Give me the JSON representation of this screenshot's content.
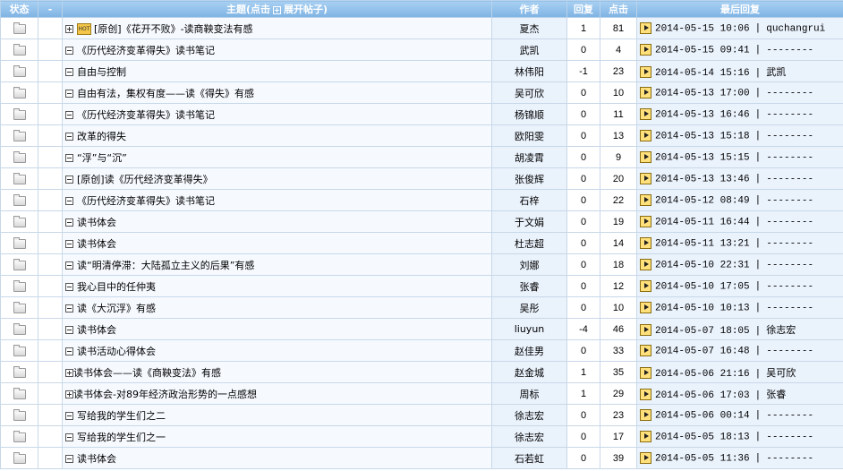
{
  "header": {
    "status": "状态",
    "dash": "-",
    "topic_prefix": "主题(点击",
    "topic_suffix": "展开帖子)",
    "author": "作者",
    "replies": "回复",
    "clicks": "点击",
    "last_reply": "最后回复"
  },
  "hot_badge": "HOT",
  "rows": [
    {
      "title": "[原创]《花开不败》-读商鞅变法有感",
      "expander": "plus",
      "hot": true,
      "author": "夏杰",
      "replies": "1",
      "clicks": "81",
      "date": "2014-05-15 10:06",
      "last_user": "quchangrui"
    },
    {
      "title": "《历代经济变革得失》读书笔记",
      "expander": "minus",
      "hot": false,
      "author": "武凯",
      "replies": "0",
      "clicks": "4",
      "date": "2014-05-15 09:41",
      "last_user": "--------"
    },
    {
      "title": "自由与控制",
      "expander": "minus",
      "hot": false,
      "author": "林伟阳",
      "replies": "-1",
      "clicks": "23",
      "date": "2014-05-14 15:16",
      "last_user": "武凯"
    },
    {
      "title": "自由有法，集权有度——读《得失》有感",
      "expander": "minus",
      "hot": false,
      "author": "吴可欣",
      "replies": "0",
      "clicks": "10",
      "date": "2014-05-13 17:00",
      "last_user": "--------"
    },
    {
      "title": "《历代经济变革得失》读书笔记",
      "expander": "minus",
      "hot": false,
      "author": "杨锦顺",
      "replies": "0",
      "clicks": "11",
      "date": "2014-05-13 16:46",
      "last_user": "--------"
    },
    {
      "title": "改革的得失",
      "expander": "minus",
      "hot": false,
      "author": "欧阳雯",
      "replies": "0",
      "clicks": "13",
      "date": "2014-05-13 15:18",
      "last_user": "--------"
    },
    {
      "title": "“浮”与“沉”",
      "expander": "minus",
      "hot": false,
      "author": "胡凌霄",
      "replies": "0",
      "clicks": "9",
      "date": "2014-05-13 15:15",
      "last_user": "--------"
    },
    {
      "title": "[原创]读《历代经济变革得失》",
      "expander": "minus",
      "hot": false,
      "author": "张俊辉",
      "replies": "0",
      "clicks": "20",
      "date": "2014-05-13 13:46",
      "last_user": "--------"
    },
    {
      "title": "《历代经济变革得失》读书笔记",
      "expander": "minus",
      "hot": false,
      "author": "石梓",
      "replies": "0",
      "clicks": "22",
      "date": "2014-05-12 08:49",
      "last_user": "--------"
    },
    {
      "title": "读书体会",
      "expander": "minus",
      "hot": false,
      "author": "于文娟",
      "replies": "0",
      "clicks": "19",
      "date": "2014-05-11 16:44",
      "last_user": "--------"
    },
    {
      "title": "读书体会",
      "expander": "minus",
      "hot": false,
      "author": "杜志超",
      "replies": "0",
      "clicks": "14",
      "date": "2014-05-11 13:21",
      "last_user": "--------"
    },
    {
      "title": "读“明清停滞：大陆孤立主义的后果”有感",
      "expander": "minus",
      "hot": false,
      "author": "刘娜",
      "replies": "0",
      "clicks": "18",
      "date": "2014-05-10 22:31",
      "last_user": "--------"
    },
    {
      "title": "我心目中的任仲夷",
      "expander": "minus",
      "hot": false,
      "author": "张睿",
      "replies": "0",
      "clicks": "12",
      "date": "2014-05-10 17:05",
      "last_user": "--------"
    },
    {
      "title": "读《大沉浮》有感",
      "expander": "minus",
      "hot": false,
      "author": "吴彤",
      "replies": "0",
      "clicks": "10",
      "date": "2014-05-10 10:13",
      "last_user": "--------"
    },
    {
      "title": "读书体会",
      "expander": "minus",
      "hot": false,
      "author": "liuyun",
      "replies": "-4",
      "clicks": "46",
      "date": "2014-05-07 18:05",
      "last_user": "徐志宏"
    },
    {
      "title": "读书活动心得体会",
      "expander": "minus",
      "hot": false,
      "author": "赵佳男",
      "replies": "0",
      "clicks": "33",
      "date": "2014-05-07 16:48",
      "last_user": "--------"
    },
    {
      "title": "读书体会——读《商鞅变法》有感",
      "expander": "plus",
      "hot": false,
      "author": "赵金城",
      "replies": "1",
      "clicks": "35",
      "date": "2014-05-06 21:16",
      "last_user": "吴可欣"
    },
    {
      "title": "读书体会-对89年经济政治形势的一点感想",
      "expander": "plus",
      "hot": false,
      "author": "周标",
      "replies": "1",
      "clicks": "29",
      "date": "2014-05-06 17:03",
      "last_user": "张睿"
    },
    {
      "title": "写给我的学生们之二",
      "expander": "minus",
      "hot": false,
      "author": "徐志宏",
      "replies": "0",
      "clicks": "23",
      "date": "2014-05-06 00:14",
      "last_user": "--------"
    },
    {
      "title": "写给我的学生们之一",
      "expander": "minus",
      "hot": false,
      "author": "徐志宏",
      "replies": "0",
      "clicks": "17",
      "date": "2014-05-05 18:13",
      "last_user": "--------"
    },
    {
      "title": "读书体会",
      "expander": "minus",
      "hot": false,
      "author": "石若虹",
      "replies": "0",
      "clicks": "39",
      "date": "2014-05-05 11:36",
      "last_user": "--------"
    }
  ],
  "icons": {
    "status": "folder-icon",
    "expand": "plus-box-icon",
    "collapse": "minus-box-icon",
    "goto": "goto-last-icon",
    "hot": "hot-topic-icon"
  },
  "colors": {
    "header": "#8bbde9",
    "topic_bg": "#f6faff",
    "meta_bg": "#eaf2fc",
    "border": "#c8d8e8"
  }
}
